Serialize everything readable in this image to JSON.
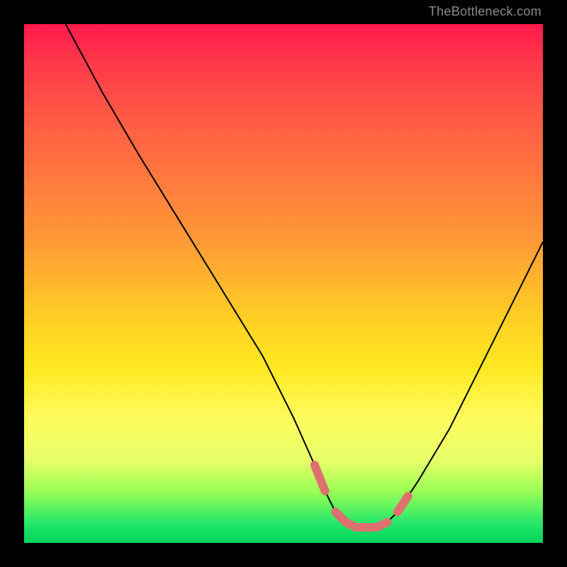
{
  "watermark": "TheBottleneck.com",
  "chart_data": {
    "type": "line",
    "title": "",
    "xlabel": "",
    "ylabel": "",
    "xlim": [
      0,
      100
    ],
    "ylim": [
      0,
      100
    ],
    "series": [
      {
        "name": "curve",
        "x": [
          8,
          15,
          22,
          30,
          38,
          46,
          52,
          56,
          58,
          60,
          62,
          64,
          66,
          68,
          70,
          72,
          76,
          82,
          88,
          94,
          100
        ],
        "values": [
          100,
          87,
          75,
          62,
          49,
          36,
          24,
          15,
          10,
          6,
          4,
          3,
          3,
          3,
          4,
          6,
          12,
          22,
          34,
          46,
          58
        ]
      }
    ],
    "highlighted_segments": [
      {
        "start_x": 56,
        "end_x": 58
      },
      {
        "start_x": 60,
        "end_x": 70
      },
      {
        "start_x": 72,
        "end_x": 74
      }
    ],
    "gradient_stops": [
      {
        "pos": 0,
        "color": "#ff1a4d"
      },
      {
        "pos": 18,
        "color": "#ff5a45"
      },
      {
        "pos": 42,
        "color": "#ff9a36"
      },
      {
        "pos": 66,
        "color": "#ffe820"
      },
      {
        "pos": 84,
        "color": "#e7ff6a"
      },
      {
        "pos": 96,
        "color": "#28e86a"
      },
      {
        "pos": 100,
        "color": "#00d45c"
      }
    ]
  }
}
